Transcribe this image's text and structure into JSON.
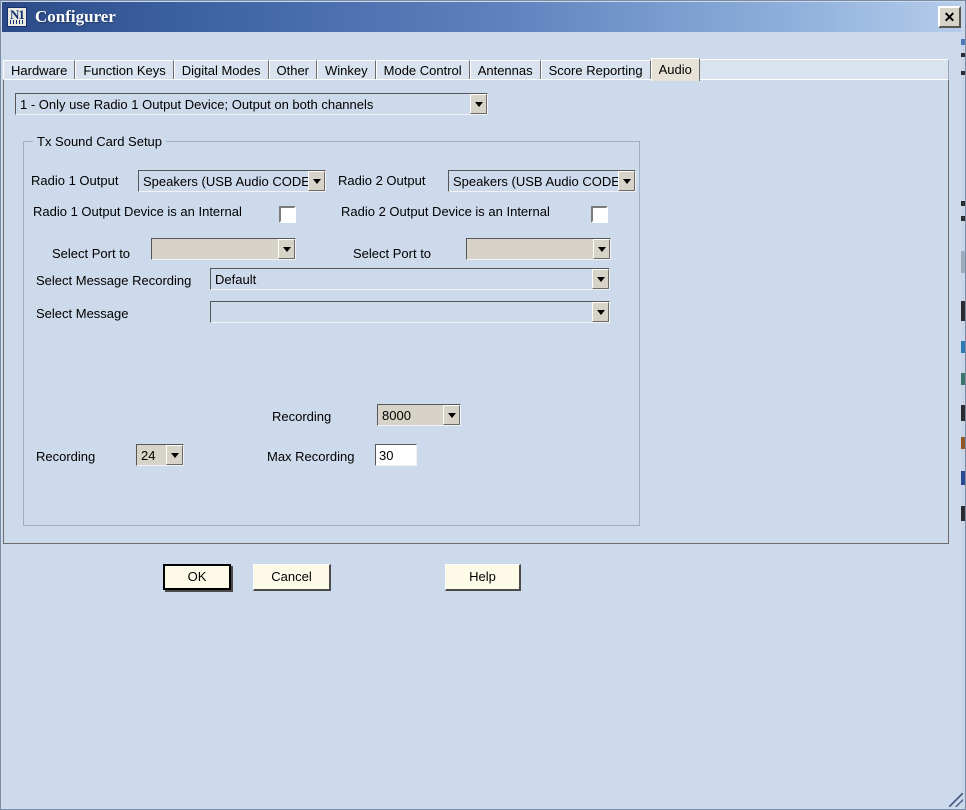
{
  "window": {
    "title": "Configurer",
    "icon": "n1mm-logo-icon",
    "close_label": "✕"
  },
  "tabs": [
    {
      "label": "Hardware",
      "selected": false
    },
    {
      "label": "Function Keys",
      "selected": false
    },
    {
      "label": "Digital Modes",
      "selected": false
    },
    {
      "label": "Other",
      "selected": false
    },
    {
      "label": "Winkey",
      "selected": false
    },
    {
      "label": "Mode Control",
      "selected": false
    },
    {
      "label": "Antennas",
      "selected": false
    },
    {
      "label": "Score Reporting",
      "selected": false
    },
    {
      "label": "Audio",
      "selected": true
    }
  ],
  "audio_tab": {
    "mode_combo": {
      "value": "1 - Only use Radio 1 Output Device; Output on both channels"
    },
    "group": {
      "title": "Tx Sound Card Setup",
      "radio1": {
        "output_label": "Radio 1 Output",
        "output_value": "Speakers (USB Audio CODE",
        "internal_label": "Radio 1 Output Device is an Internal",
        "internal_checked": false,
        "port_label": "Select Port to",
        "port_value": ""
      },
      "radio2": {
        "output_label": "Radio 2 Output",
        "output_value": "Speakers (USB Audio CODE",
        "internal_label": "Radio 2 Output Device is an Internal",
        "internal_checked": false,
        "port_label": "Select Port to",
        "port_value": ""
      },
      "message_recording": {
        "label": "Select Message Recording",
        "value": "Default"
      },
      "select_message": {
        "label": "Select Message",
        "value": ""
      },
      "recording_rate": {
        "label": "Recording",
        "value": "8000"
      },
      "recording_bits": {
        "label": "Recording",
        "value": "24"
      },
      "max_recording": {
        "label": "Max Recording",
        "value": "30"
      }
    }
  },
  "buttons": {
    "ok": "OK",
    "cancel": "Cancel",
    "help": "Help"
  }
}
